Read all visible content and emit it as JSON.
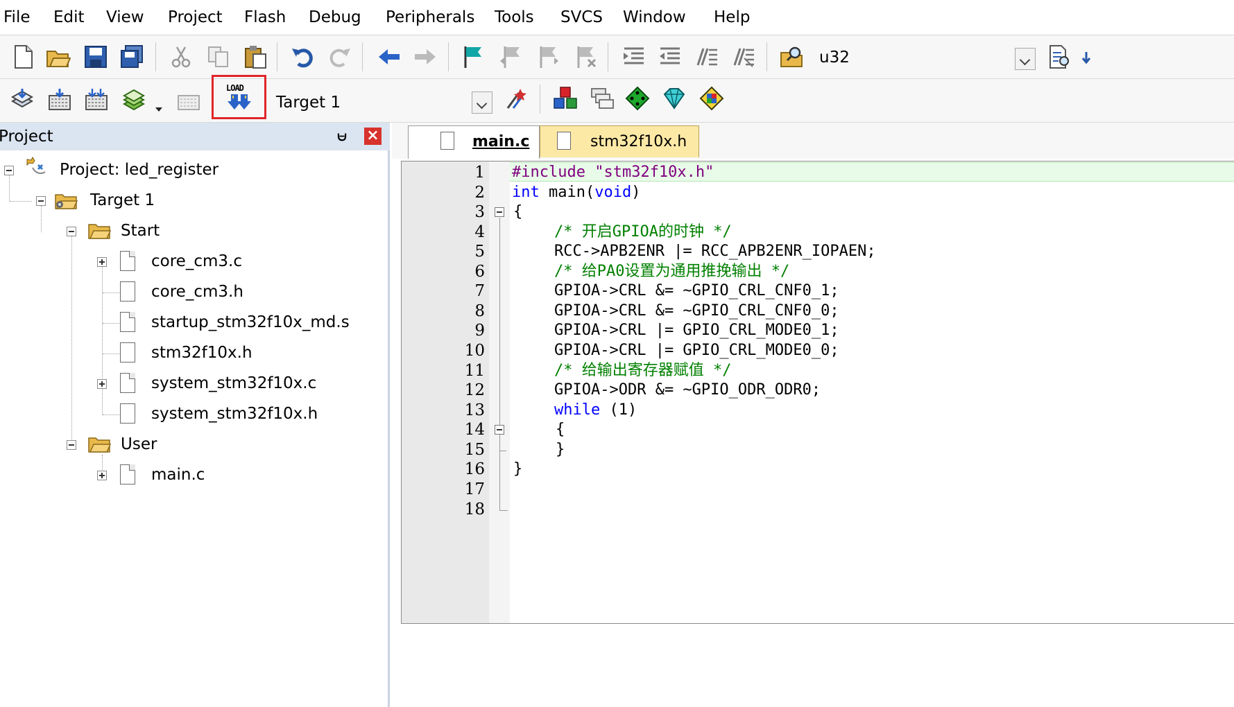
{
  "menu": [
    "File",
    "Edit",
    "View",
    "Project",
    "Flash",
    "Debug",
    "Peripherals",
    "Tools",
    "SVCS",
    "Window",
    "Help"
  ],
  "toolbar": {
    "search_text": "u32",
    "target_name": "Target 1",
    "load_label": "LOAD"
  },
  "project_panel": {
    "title": "Project",
    "pin": "⩁",
    "close": "×",
    "tree": {
      "root": "Project: led_register",
      "target": "Target 1",
      "group_start": "Start",
      "start_files": [
        "core_cm3.c",
        "core_cm3.h",
        "startup_stm32f10x_md.s",
        "stm32f10x.h",
        "system_stm32f10x.c",
        "system_stm32f10x.h"
      ],
      "group_user": "User",
      "user_files": [
        "main.c"
      ]
    }
  },
  "editor": {
    "tabs": [
      "main.c",
      "stm32f10x.h"
    ],
    "line_numbers": [
      "1",
      "2",
      "3",
      "4",
      "5",
      "6",
      "7",
      "8",
      "9",
      "10",
      "11",
      "12",
      "13",
      "14",
      "15",
      "16",
      "17",
      "18"
    ],
    "code": {
      "l1_pp": "#include ",
      "l1_str": "\"stm32f10x.h\"",
      "l2_kw": "int",
      "l2_mid": " main(",
      "l2_kw2": "void",
      "l2_end": ")",
      "l3": "{",
      "l4": "/* 开启GPIOA的时钟 */",
      "l5": "RCC->APB2ENR |= RCC_APB2ENR_IOPAEN;",
      "l6": "/* 给PA0设置为通用推挽输出 */",
      "l7": "GPIOA->CRL &= ~GPIO_CRL_CNF0_1;",
      "l8": "GPIOA->CRL &= ~GPIO_CRL_CNF0_0;",
      "l9": "GPIOA->CRL |= GPIO_CRL_MODE0_1;",
      "l10": "GPIOA->CRL |= GPIO_CRL_MODE0_0;",
      "l11": "/* 给输出寄存器赋值 */",
      "l12": "GPIOA->ODR &= ~GPIO_ODR_ODR0;",
      "l13_kw": "while",
      "l13_rest": " (1)",
      "l14": "{",
      "l15": "}",
      "l16": "}"
    }
  },
  "colors": {
    "keyword": "#0000ff",
    "preprocessor": "#800080",
    "comment": "#008000",
    "highlight_box": "#e0262a",
    "active_tab": "#ffffff",
    "inactive_tab": "#fde9a6",
    "project_header": "#dbe5f1"
  }
}
